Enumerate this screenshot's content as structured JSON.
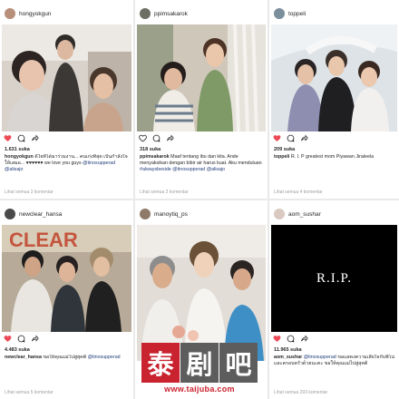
{
  "posts": [
    {
      "username": "hongyokgun",
      "likes": "1.631 suka",
      "caption_user": "hongyokgun",
      "caption_text": "ดีใจที่ได้มาร่วมงาน... คนเก่งที่สุด เป็นกำลังใจให้เสมอ... ♥♥♥♥♥♥ we love you guys",
      "caption_tags": "@tinosupperad @alisajo",
      "comments_link": "Lihat semua 3 komentar",
      "avatar_color": "#b88f7a"
    },
    {
      "username": "ppimsakarok",
      "likes": "318 suka",
      "caption_user": "ppimsakarok",
      "caption_text": "Maaf tentang ibu dan kita. Ande menyaksikan dengan bibir air harus kuat. Aku menduluan",
      "caption_tags": "#alwaysbeside @tinosupperad @alisajo",
      "comments_link": "Lihat semua 3 komentar",
      "avatar_color": "#6d6e64"
    },
    {
      "username": "toppeli",
      "likes": "209 suka",
      "caption_user": "toppeli",
      "caption_text": "R. I. P greatest mom Piyawan Jiraleela",
      "caption_tags": "",
      "comments_link": "Lihat semua 4 komentar",
      "avatar_color": "#7a8e9c"
    },
    {
      "username": "newclear_hansa",
      "likes": "4.483 suka",
      "caption_user": "newclear_hansa",
      "caption_text": "ขอให้คุณแม่ไปสู่สุคติ",
      "caption_tags": "@tinosupperad",
      "comments_link": "Lihat semua 5 komentar",
      "avatar_color": "#4a4a4a"
    },
    {
      "username": "manoytiq_ps",
      "likes": "",
      "caption_user": "",
      "caption_text": "",
      "caption_tags": "",
      "comments_link": "",
      "avatar_color": "#8f7a6a"
    },
    {
      "username": "aom_sushar",
      "likes": "11.965 suka",
      "caption_user": "aom_sushar",
      "caption_text": "ขอแสดงความเสียใจกับพี่โน่และครอบครัวด้วยนะคะ ขอให้คุณแม่ไปสู่สุคติ",
      "caption_tags": "@tinosupperad",
      "comments_link": "Lihat semua 293 komentar",
      "avatar_color": "#d9c9c0",
      "image_text": "R.I.P."
    }
  ],
  "watermark": {
    "logo_chars": [
      "泰",
      "剧",
      "吧"
    ],
    "url": "www.taijuba.com"
  },
  "icons": {
    "like": "heart-icon",
    "comment": "comment-icon",
    "share": "share-icon"
  },
  "colors": {
    "like_red": "#ed4956",
    "hashtag": "#223e7a",
    "watermark_red": "#c9232f"
  }
}
